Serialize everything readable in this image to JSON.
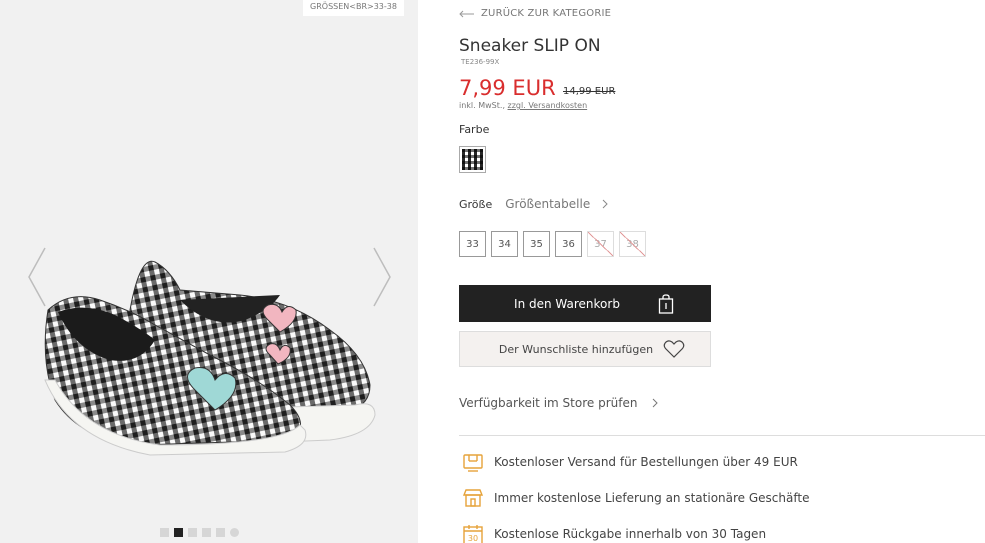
{
  "gallery": {
    "size_badge": "GRÖSSEN<BR>33-38",
    "slide_count": 6,
    "active_slide": 2
  },
  "nav": {
    "back_label": "ZURÜCK ZUR KATEGORIE"
  },
  "product": {
    "title": "Sneaker SLIP ON",
    "sku": "TE236-99X",
    "price": "7,99 EUR",
    "old_price": "14,99 EUR",
    "tax_note": "inkl. MwSt.,",
    "shipping_link": "zzgl. Versandkosten"
  },
  "color": {
    "label": "Farbe",
    "selected": "gingham-black-white"
  },
  "size": {
    "label": "Größe",
    "table_link": "Größentabelle",
    "options": [
      {
        "label": "33",
        "available": true
      },
      {
        "label": "34",
        "available": true
      },
      {
        "label": "35",
        "available": true
      },
      {
        "label": "36",
        "available": true
      },
      {
        "label": "37",
        "available": false
      },
      {
        "label": "38",
        "available": false
      }
    ]
  },
  "actions": {
    "cart_label": "In den Warenkorb",
    "wishlist_label": "Der Wunschliste hinzufügen",
    "store_check_label": "Verfügbarkeit im Store prüfen"
  },
  "benefits": [
    {
      "icon": "truck-icon",
      "text": "Kostenloser Versand für Bestellungen über 49 EUR"
    },
    {
      "icon": "store-icon",
      "text": "Immer kostenlose Lieferung an stationäre Geschäfte"
    },
    {
      "icon": "calendar-30-icon",
      "text": "Kostenlose Rückgabe innerhalb von 30 Tagen"
    }
  ],
  "colors": {
    "price": "#d92d2d",
    "cart_button": "#222222",
    "benefit_icon": "#e6a33a"
  }
}
